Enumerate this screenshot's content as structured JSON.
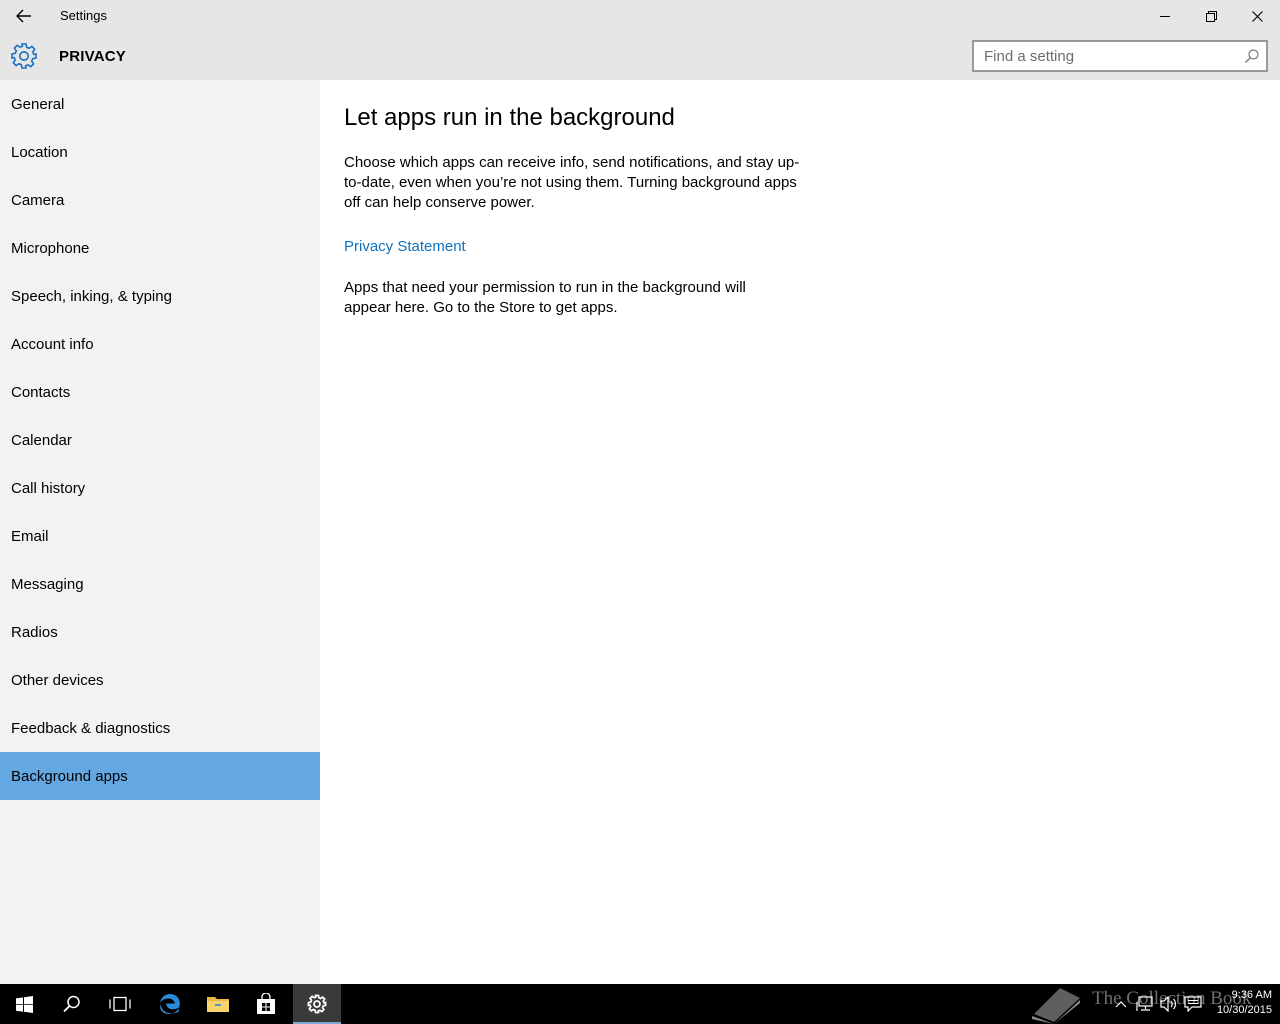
{
  "window": {
    "title": "Settings"
  },
  "header": {
    "section_title": "PRIVACY",
    "search_placeholder": "Find a setting"
  },
  "sidebar": {
    "items": [
      {
        "label": "General"
      },
      {
        "label": "Location"
      },
      {
        "label": "Camera"
      },
      {
        "label": "Microphone"
      },
      {
        "label": "Speech, inking, & typing"
      },
      {
        "label": "Account info"
      },
      {
        "label": "Contacts"
      },
      {
        "label": "Calendar"
      },
      {
        "label": "Call history"
      },
      {
        "label": "Email"
      },
      {
        "label": "Messaging"
      },
      {
        "label": "Radios"
      },
      {
        "label": "Other devices"
      },
      {
        "label": "Feedback & diagnostics"
      },
      {
        "label": "Background apps",
        "selected": true
      }
    ]
  },
  "main": {
    "heading": "Let apps run in the background",
    "description": "Choose which apps can receive info, send notifications, and stay up-to-date, even when you’re not using them. Turning background apps off can help conserve power.",
    "privacy_link": "Privacy Statement",
    "empty_text": "Apps that need your permission to run in the background will appear here. Go to the Store to get apps."
  },
  "taskbar": {
    "pinned": [
      "windows-start",
      "search",
      "task-view",
      "edge",
      "file-explorer",
      "store",
      "settings"
    ],
    "active": "settings",
    "watermark_text": "The Collection Book",
    "clock_time": "9:36 AM",
    "clock_date": "10/30/2015"
  },
  "colors": {
    "accent": "#64a8e2",
    "link": "#0f73c2",
    "chrome": "#e6e6e6",
    "sidebar": "#f2f2f2",
    "taskbar": "#000000"
  }
}
